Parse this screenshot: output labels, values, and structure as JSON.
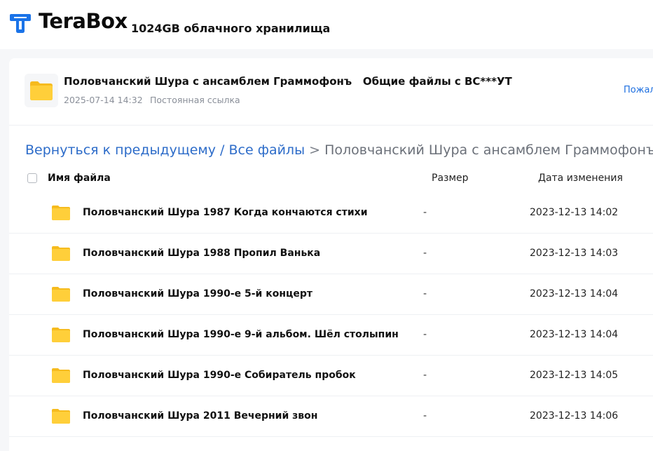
{
  "header": {
    "logo_text": "TeraBox",
    "tagline": "1024GB облачного хранилища",
    "brand_color": "#1a73e8"
  },
  "share": {
    "title": "Половчанский Шура с ансамблем Граммофонъ   Общие файлы с BC***УТ",
    "date": "2025-07-14 14:32",
    "permalink": "Постоянная ссылка",
    "report": "Пожаловаться"
  },
  "breadcrumb": {
    "back": "Вернуться к предыдущему / Все файлы",
    "separator": " > ",
    "current": "Половчанский Шура с ансамблем Граммофонъ"
  },
  "table": {
    "columns": {
      "name": "Имя файла",
      "size": "Размер",
      "date": "Дата изменения"
    },
    "rows": [
      {
        "name": "Половчанский Шура 1987 Когда кончаются стихи",
        "size": "-",
        "date": "2023-12-13 14:02",
        "icon": "folder-icon"
      },
      {
        "name": "Половчанский Шура 1988 Пропил Ванька",
        "size": "-",
        "date": "2023-12-13 14:03",
        "icon": "folder-icon"
      },
      {
        "name": "Половчанский Шура 1990-е 5-й концерт",
        "size": "-",
        "date": "2023-12-13 14:04",
        "icon": "folder-icon"
      },
      {
        "name": "Половчанский Шура 1990-е 9-й альбом. Шёл столыпин",
        "size": "-",
        "date": "2023-12-13 14:04",
        "icon": "folder-icon"
      },
      {
        "name": "Половчанский Шура 1990-е Собиратель пробок",
        "size": "-",
        "date": "2023-12-13 14:05",
        "icon": "folder-icon"
      },
      {
        "name": "Половчанский Шура 2011 Вечерний звон",
        "size": "-",
        "date": "2023-12-13 14:06",
        "icon": "folder-icon"
      }
    ]
  }
}
